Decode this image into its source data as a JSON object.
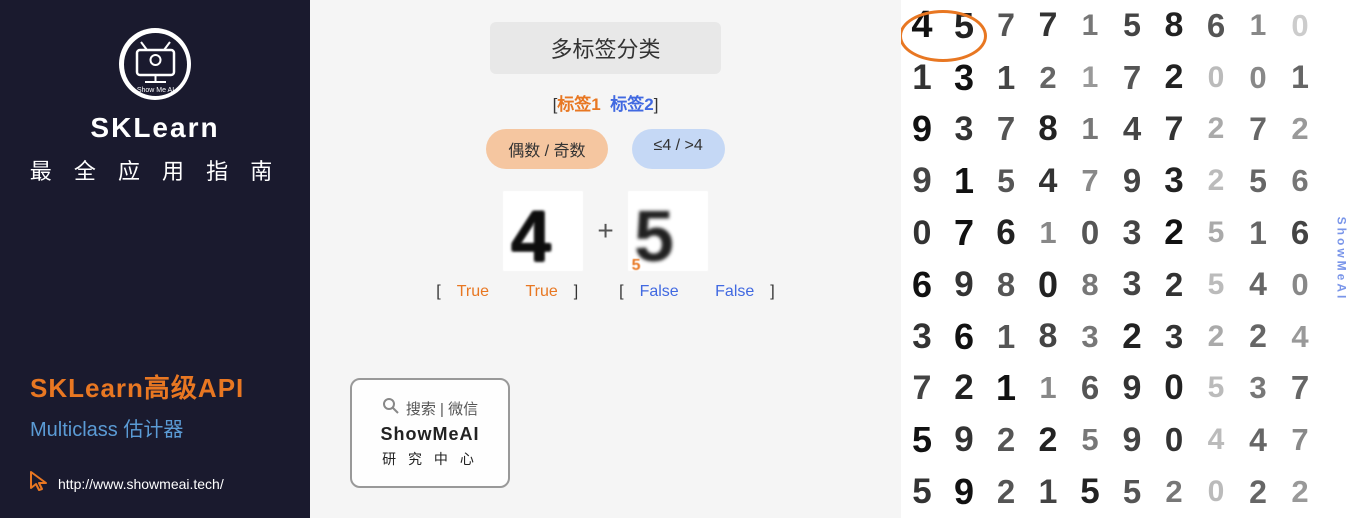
{
  "left": {
    "logo_text": "Show Me AI",
    "brand": "SKLearn",
    "subtitle": "最 全 应 用 指 南",
    "highlight": "SKLearn高级API",
    "sub": "Multiclass 估计器",
    "link": "http://www.showmeai.tech/"
  },
  "middle": {
    "section_title": "多标签分类",
    "tags_prefix": "[",
    "tag1": "标签1",
    "tag_sep": "  ",
    "tag2": "标签2",
    "tags_suffix": "]",
    "label1": "偶数 / 奇数",
    "label2": "≤4 / >4",
    "digit1": "4",
    "digit2": "5",
    "result1_prefix": "[",
    "result1_true1": "True",
    "result1_space": " ",
    "result1_true2": "True",
    "result1_suffix": "]",
    "result2_prefix": "[",
    "result2_false1": "False",
    "result2_space": " ",
    "result2_false2": "False",
    "result2_suffix": "]",
    "search_text": "搜索 | 微信",
    "brand_wm": "ShowMeAI",
    "center_wm": "研 究 中 心"
  },
  "right": {
    "highlighted_digit": "45",
    "watermark": "ShowMeAI",
    "digits": [
      [
        "4",
        "5",
        "7",
        "7",
        "1",
        "5",
        "8",
        "6",
        "1",
        "0"
      ],
      [
        "1",
        "3",
        "1",
        "2",
        "1",
        "7",
        "2",
        "0",
        "0",
        "1"
      ],
      [
        "9",
        "3",
        "7",
        "8",
        "1",
        "4",
        "7",
        "2",
        "7",
        "2"
      ],
      [
        "9",
        "1",
        "5",
        "4",
        "7",
        "9",
        "3",
        "2",
        "5",
        "6"
      ],
      [
        "0",
        "7",
        "6",
        "1",
        "0",
        "3",
        "2",
        "5",
        "1",
        "6"
      ],
      [
        "6",
        "9",
        "8",
        "0",
        "8",
        "3",
        "2",
        "5",
        "4",
        "0"
      ],
      [
        "3",
        "6",
        "1",
        "8",
        "3",
        "2",
        "3",
        "2",
        "2",
        "4"
      ],
      [
        "7",
        "2",
        "1",
        "1",
        "6",
        "9",
        "0",
        "5",
        "3",
        "7"
      ],
      [
        "5",
        "9",
        "2",
        "2",
        "5",
        "9",
        "0",
        "4",
        "4",
        "7"
      ],
      [
        "5",
        "9",
        "2",
        "1",
        "5",
        "5",
        "2",
        "0",
        "2",
        "2"
      ]
    ]
  }
}
